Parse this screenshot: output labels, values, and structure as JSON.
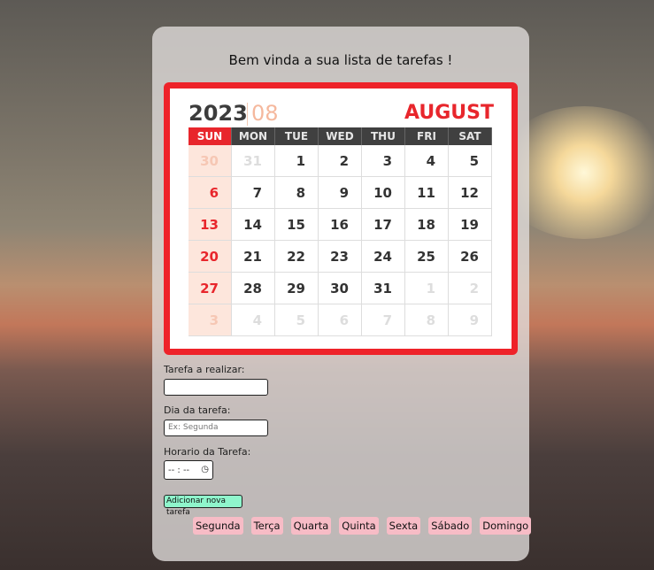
{
  "title": "Bem vinda a sua lista de tarefas !",
  "calendar": {
    "year": "2023",
    "month_num": "08",
    "month_name": "AUGUST",
    "weekdays": [
      "SUN",
      "MON",
      "TUE",
      "WED",
      "THU",
      "FRI",
      "SAT"
    ],
    "weeks": [
      [
        "30",
        "31",
        "1",
        "2",
        "3",
        "4",
        "5"
      ],
      [
        "6",
        "7",
        "8",
        "9",
        "10",
        "11",
        "12"
      ],
      [
        "13",
        "14",
        "15",
        "16",
        "17",
        "18",
        "19"
      ],
      [
        "20",
        "21",
        "22",
        "23",
        "24",
        "25",
        "26"
      ],
      [
        "27",
        "28",
        "29",
        "30",
        "31",
        "1",
        "2"
      ],
      [
        "3",
        "4",
        "5",
        "6",
        "7",
        "8",
        "9"
      ]
    ]
  },
  "form": {
    "task_label": "Tarefa a realizar:",
    "task_value": "",
    "day_label": "Dia da tarefa:",
    "day_placeholder": "Ex: Segunda",
    "time_label": "Horario da Tarefa:",
    "time_value": "-- : --",
    "add_button": "Adicionar nova tarefa"
  },
  "day_buttons": [
    "Segunda",
    "Terça",
    "Quarta",
    "Quinta",
    "Sexta",
    "Sábado",
    "Domingo"
  ]
}
